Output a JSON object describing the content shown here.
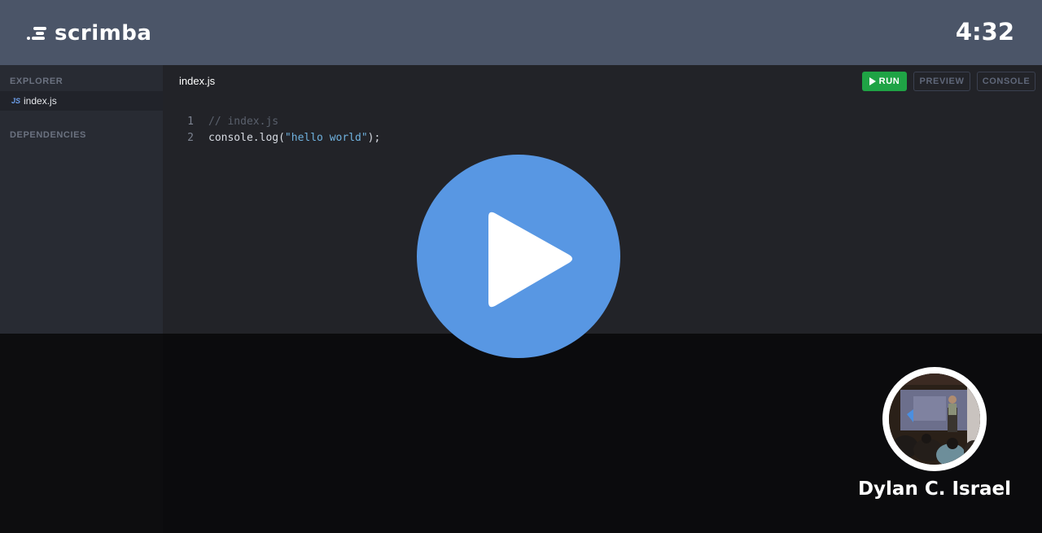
{
  "header": {
    "logo_text": "scrimba",
    "timer": "4:32"
  },
  "sidebar": {
    "explorer_heading": "EXPLORER",
    "files": [
      {
        "badge": "JS",
        "name": "index.js"
      }
    ],
    "dependencies_heading": "DEPENDENCIES"
  },
  "editor": {
    "tab_title": "index.js",
    "buttons": {
      "run": "RUN",
      "preview": "PREVIEW",
      "console": "CONSOLE"
    },
    "lines": [
      {
        "number": "1",
        "comment": "// index.js"
      },
      {
        "number": "2",
        "code_prefix": "console.log(",
        "string": "\"hello world\"",
        "code_suffix": ");"
      }
    ]
  },
  "player": {
    "play_icon": "play-icon"
  },
  "presenter": {
    "name": "Dylan C. Israel"
  },
  "colors": {
    "header_bg": "#4b5568",
    "run_green": "#1fa345",
    "play_blue": "#5897e3",
    "string_blue": "#6fb1de"
  }
}
